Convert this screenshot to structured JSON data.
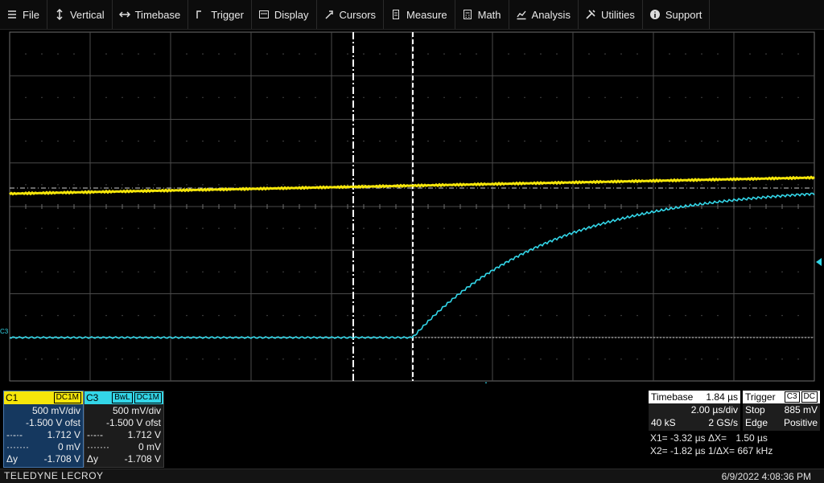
{
  "menu": [
    {
      "label": "File",
      "icon": "hamburger-icon",
      "name": "menu-file"
    },
    {
      "label": "Vertical",
      "icon": "vertical-arrows-icon",
      "name": "menu-vertical"
    },
    {
      "label": "Timebase",
      "icon": "horizontal-arrows-icon",
      "name": "menu-timebase"
    },
    {
      "label": "Trigger",
      "icon": "trigger-edge-icon",
      "name": "menu-trigger"
    },
    {
      "label": "Display",
      "icon": "display-icon",
      "name": "menu-display"
    },
    {
      "label": "Cursors",
      "icon": "cursor-icon",
      "name": "menu-cursors"
    },
    {
      "label": "Measure",
      "icon": "measure-icon",
      "name": "menu-measure"
    },
    {
      "label": "Math",
      "icon": "calculator-icon",
      "name": "menu-math"
    },
    {
      "label": "Analysis",
      "icon": "analysis-chart-icon",
      "name": "menu-analysis"
    },
    {
      "label": "Utilities",
      "icon": "tools-icon",
      "name": "menu-utilities"
    },
    {
      "label": "Support",
      "icon": "info-icon",
      "name": "menu-support"
    }
  ],
  "colors": {
    "c1": "#f5e60a",
    "c3": "#33d6e8",
    "grid": "#6e6e6e",
    "cursor": "#ffffff"
  },
  "waveform": {
    "c1": {
      "desc": "flat slightly rising trace"
    },
    "c3": {
      "desc": "flat then exponential rise starting at second cursor"
    },
    "c3_marker": "C3"
  },
  "channels": {
    "c1": {
      "name": "C1",
      "coupling": "DC1M",
      "vdiv": "500 mV/div",
      "offset": "-1.500 V ofst",
      "y1": "1.712 V",
      "y2": "0 mV",
      "dy_label": "Δy",
      "dy": "-1.708 V"
    },
    "c3": {
      "name": "C3",
      "bw": "BwL",
      "coupling": "DC1M",
      "vdiv": "500 mV/div",
      "offset": "-1.500 V ofst",
      "y1": "1.712 V",
      "y2": "0 mV",
      "dy_label": "Δy",
      "dy": "-1.708 V"
    }
  },
  "timebase": {
    "label": "Timebase",
    "delay": "1.84 µs",
    "tdiv": "2.00 µs/div",
    "samples": "40 kS",
    "rate": "2 GS/s"
  },
  "trigger": {
    "label": "Trigger",
    "source": "C3",
    "coupling": "DC",
    "mode": "Stop",
    "level": "885 mV",
    "type": "Edge",
    "slope": "Positive"
  },
  "cursors": {
    "x1": "X1= -3.32 µs ΔX=",
    "dx": "1.50 µs",
    "x2": "X2= -1.82 µs 1/ΔX= 667 kHz"
  },
  "status": {
    "brand": "TELEDYNE LECROY",
    "datetime": "6/9/2022 4:08:36 PM"
  }
}
